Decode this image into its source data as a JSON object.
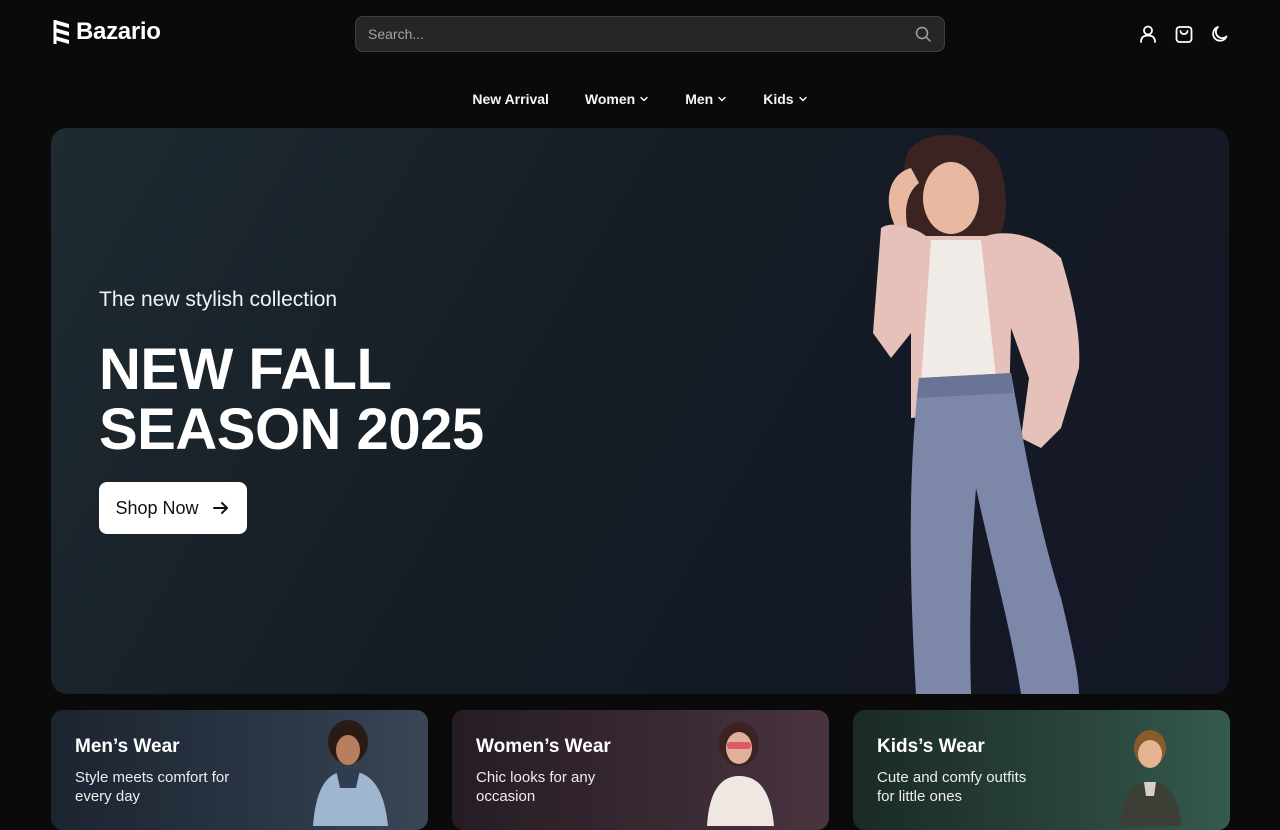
{
  "brand": {
    "name": "Bazario"
  },
  "search": {
    "placeholder": "Search..."
  },
  "header": {
    "icons": [
      "user-icon",
      "cart-icon",
      "moon-icon"
    ]
  },
  "nav": {
    "items": [
      {
        "label": "New Arrival",
        "has_dropdown": false
      },
      {
        "label": "Women",
        "has_dropdown": true
      },
      {
        "label": "Men",
        "has_dropdown": true
      },
      {
        "label": "Kids",
        "has_dropdown": true
      }
    ]
  },
  "hero": {
    "subtitle": "The new stylish collection",
    "title_line1": "NEW FALL",
    "title_line2": "SEASON 2025",
    "cta_label": "Shop Now"
  },
  "categories": [
    {
      "title": "Men’s Wear",
      "description": "Style meets comfort for every day"
    },
    {
      "title": "Women’s Wear",
      "description": "Chic looks for any occasion"
    },
    {
      "title": "Kids’s Wear",
      "description": "Cute and comfy outfits for little ones"
    }
  ],
  "colors": {
    "background": "#0a0a0a",
    "search_bg": "#262626",
    "cta_bg": "#ffffff",
    "cta_text": "#111111"
  }
}
